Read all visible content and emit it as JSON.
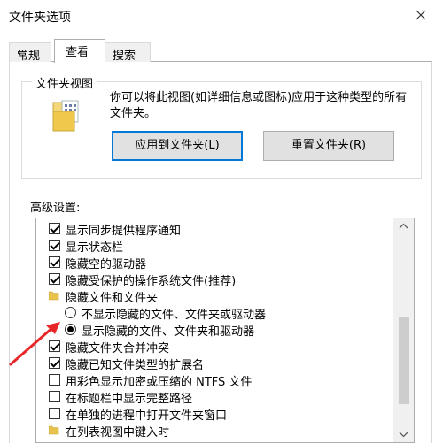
{
  "window": {
    "title": "文件夹选项"
  },
  "tabs": [
    {
      "label": "常规",
      "active": false
    },
    {
      "label": "查看",
      "active": true
    },
    {
      "label": "搜索",
      "active": false
    }
  ],
  "folder_views": {
    "group_label": "文件夹视图",
    "description": "你可以将此视图(如详细信息或图标)应用于这种类型的所有文件夹。",
    "apply_button": "应用到文件夹(L)",
    "reset_button": "重置文件夹(R)"
  },
  "advanced": {
    "label": "高级设置:",
    "items": [
      {
        "type": "checkbox",
        "checked": true,
        "indent": 0,
        "label": "显示同步提供程序通知"
      },
      {
        "type": "checkbox",
        "checked": true,
        "indent": 0,
        "label": "显示状态栏"
      },
      {
        "type": "checkbox",
        "checked": true,
        "indent": 0,
        "label": "隐藏空的驱动器"
      },
      {
        "type": "checkbox",
        "checked": true,
        "indent": 0,
        "label": "隐藏受保护的操作系统文件(推荐)"
      },
      {
        "type": "folder",
        "indent": 0,
        "label": "隐藏文件和文件夹"
      },
      {
        "type": "radio",
        "selected": false,
        "indent": 1,
        "label": "不显示隐藏的文件、文件夹或驱动器"
      },
      {
        "type": "radio",
        "selected": true,
        "indent": 1,
        "label": "显示隐藏的文件、文件夹和驱动器"
      },
      {
        "type": "checkbox",
        "checked": true,
        "indent": 0,
        "label": "隐藏文件夹合并冲突"
      },
      {
        "type": "checkbox",
        "checked": true,
        "indent": 0,
        "label": "隐藏已知文件类型的扩展名"
      },
      {
        "type": "checkbox",
        "checked": false,
        "indent": 0,
        "label": "用彩色显示加密或压缩的 NTFS 文件"
      },
      {
        "type": "checkbox",
        "checked": false,
        "indent": 0,
        "label": "在标题栏中显示完整路径"
      },
      {
        "type": "checkbox",
        "checked": false,
        "indent": 0,
        "label": "在单独的进程中打开文件夹窗口"
      },
      {
        "type": "folder",
        "indent": 0,
        "label": "在列表视图中键入时"
      }
    ]
  },
  "colors": {
    "accent": "#0078d7",
    "annotation_arrow": "#e8262a",
    "folder": "#e8c24a"
  }
}
